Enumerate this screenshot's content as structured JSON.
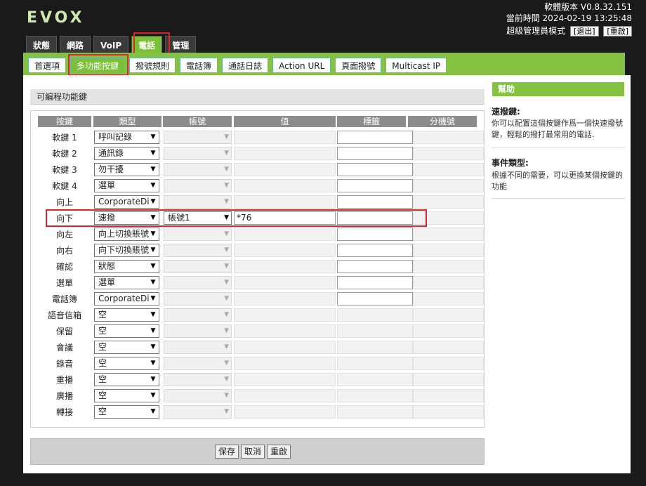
{
  "header": {
    "logo": "EVOX",
    "version": "軟體版本 V0.8.32.151",
    "time": "當前時間 2024-02-19 13:25:48",
    "mode": "超級管理員模式",
    "logout": "[退出]",
    "restart": "[重啟]"
  },
  "top_tabs": [
    "狀態",
    "網路",
    "VoIP",
    "電話",
    "管理"
  ],
  "sub_tabs": [
    "首選項",
    "多功能按鍵",
    "撥號規則",
    "電話簿",
    "通話日誌",
    "Action URL",
    "頁面撥號",
    "Multicast IP"
  ],
  "section_title": "可編程功能鍵",
  "columns": [
    "按鍵",
    "類型",
    "帳號",
    "值",
    "標籤",
    "分機號"
  ],
  "rows": [
    {
      "key": "軟鍵 1",
      "type": "呼叫記錄",
      "account": "",
      "value": ""
    },
    {
      "key": "軟鍵 2",
      "type": "通訊錄",
      "account": "",
      "value": ""
    },
    {
      "key": "軟鍵 3",
      "type": "勿干擾",
      "account": "",
      "value": ""
    },
    {
      "key": "軟鍵 4",
      "type": "選單",
      "account": "",
      "value": ""
    },
    {
      "key": "向上",
      "type": "CorporateDire",
      "account": "",
      "value": ""
    },
    {
      "key": "向下",
      "type": "速撥",
      "account": "帳號1",
      "value": "*76"
    },
    {
      "key": "向左",
      "type": "向上切換賬號",
      "account": "",
      "value": ""
    },
    {
      "key": "向右",
      "type": "向下切換賬號",
      "account": "",
      "value": ""
    },
    {
      "key": "確認",
      "type": "狀態",
      "account": "",
      "value": ""
    },
    {
      "key": "選單",
      "type": "選單",
      "account": "",
      "value": ""
    },
    {
      "key": "電話簿",
      "type": "CorporateDire",
      "account": "",
      "value": ""
    },
    {
      "key": "語音信箱",
      "type": "空",
      "account": "",
      "value": ""
    },
    {
      "key": "保留",
      "type": "空",
      "account": "",
      "value": ""
    },
    {
      "key": "會議",
      "type": "空",
      "account": "",
      "value": ""
    },
    {
      "key": "錄音",
      "type": "空",
      "account": "",
      "value": ""
    },
    {
      "key": "重播",
      "type": "空",
      "account": "",
      "value": ""
    },
    {
      "key": "廣播",
      "type": "空",
      "account": "",
      "value": ""
    },
    {
      "key": "轉接",
      "type": "空",
      "account": "",
      "value": ""
    }
  ],
  "buttons": {
    "save": "保存",
    "cancel": "取消",
    "reboot": "重啟"
  },
  "help": {
    "title": "幫助",
    "h1": "速撥鍵:",
    "t1": "你可以配置這個按鍵作爲一個快速撥號鍵，輕鬆的撥打最常用的電話.",
    "h2": "事件類型:",
    "t2": "根據不同的需要，可以更換某個按鍵的功能"
  },
  "colors": {
    "accent": "#86c242",
    "highlight": "#e0242a"
  }
}
